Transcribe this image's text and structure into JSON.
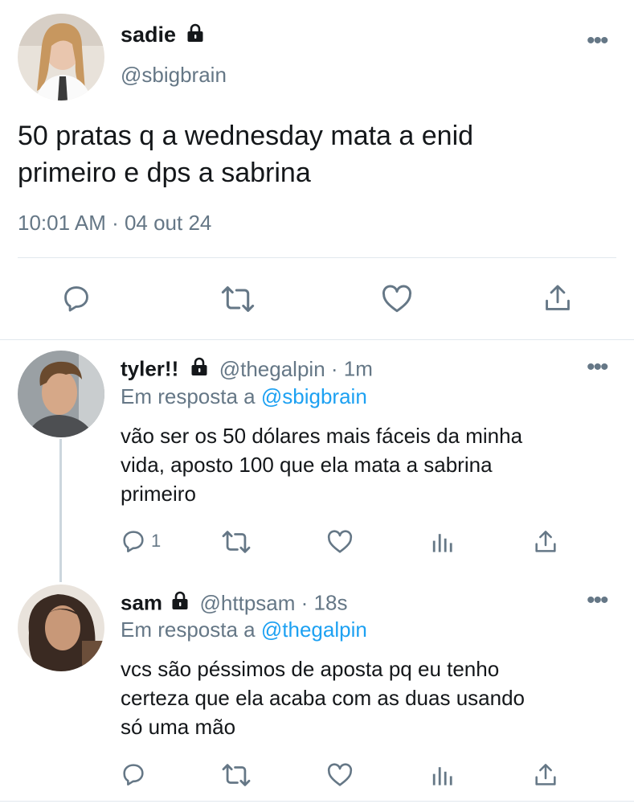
{
  "main_tweet": {
    "name": "sadie",
    "handle": "@sbigbrain",
    "text_line1": "50 pratas q a wednesday mata a enid",
    "text_line2": "primeiro e dps a sabrina",
    "timestamp": "10:01 AM · 04 out 24",
    "more_icon": "more-horizontal-icon"
  },
  "replies": [
    {
      "name": "tyler!!",
      "handle": "@thegalpin",
      "time": "· 1m",
      "reply_prefix": "Em resposta a",
      "reply_to": "@sbigbrain",
      "text_line1": "vão ser os 50 dólares mais fáceis da minha",
      "text_line2": "vida, aposto 100 que ela mata a sabrina",
      "text_line3": "primeiro",
      "reply_count": "1"
    },
    {
      "name": "sam",
      "handle": "@httpsam",
      "time": "· 18s",
      "reply_prefix": "Em resposta a",
      "reply_to": "@thegalpin",
      "text_line1": "vcs são péssimos de aposta pq eu tenho",
      "text_line2": "certeza que ela acaba com as duas usando",
      "text_line3": "só uma mão",
      "reply_count": ""
    }
  ],
  "colors": {
    "accent": "#1da1f2",
    "muted": "#657786",
    "icon": "#1da1f2",
    "divider": "#e1e8ed"
  },
  "icons": [
    "lock-icon",
    "reply-icon",
    "retweet-icon",
    "like-icon",
    "share-icon",
    "analytics-icon",
    "more-icon"
  ]
}
